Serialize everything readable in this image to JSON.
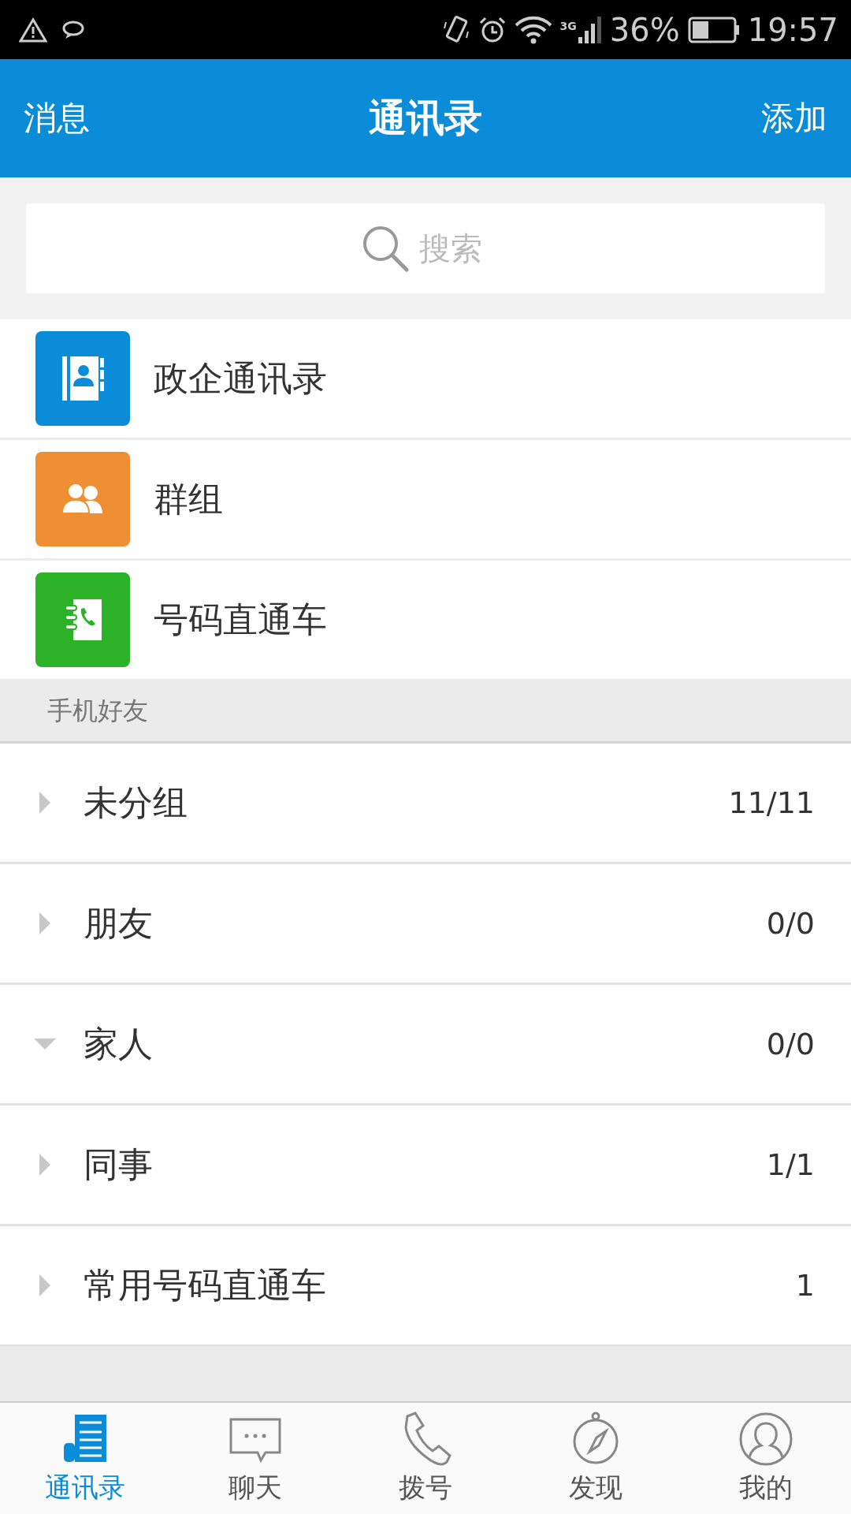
{
  "status_bar": {
    "network": "3G",
    "battery": "36%",
    "time": "19:57"
  },
  "header": {
    "left": "消息",
    "title": "通讯录",
    "right": "添加"
  },
  "search": {
    "placeholder": "搜索"
  },
  "features": [
    {
      "kind": "directory",
      "label": "政企通讯录"
    },
    {
      "kind": "group",
      "label": "群组"
    },
    {
      "kind": "dial",
      "label": "号码直通车"
    }
  ],
  "section": {
    "title": "手机好友"
  },
  "groups": [
    {
      "name": "未分组",
      "count": "11/11",
      "expanded": false
    },
    {
      "name": "朋友",
      "count": "0/0",
      "expanded": false
    },
    {
      "name": "家人",
      "count": "0/0",
      "expanded": true
    },
    {
      "name": "同事",
      "count": "1/1",
      "expanded": false
    },
    {
      "name": "常用号码直通车",
      "count": "1",
      "expanded": false
    }
  ],
  "tabs": [
    {
      "kind": "contacts",
      "label": "通讯录",
      "selected": true
    },
    {
      "kind": "chat",
      "label": "聊天",
      "selected": false
    },
    {
      "kind": "dial",
      "label": "拨号",
      "selected": false
    },
    {
      "kind": "discover",
      "label": "发现",
      "selected": false
    },
    {
      "kind": "me",
      "label": "我的",
      "selected": false
    }
  ]
}
